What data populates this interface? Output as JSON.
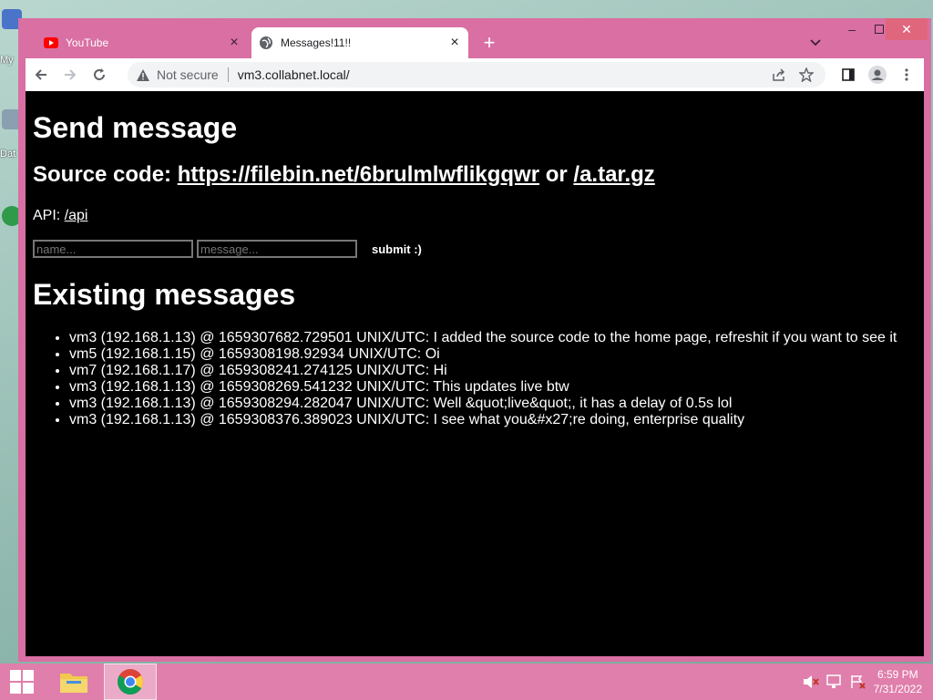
{
  "desktop": {
    "icon_labels": [
      "My",
      "Dat"
    ]
  },
  "browser": {
    "tabs": [
      {
        "title": "YouTube",
        "active": false,
        "favicon": "youtube-icon"
      },
      {
        "title": "Messages!11!!",
        "active": true,
        "favicon": "globe-icon"
      }
    ],
    "address_bar": {
      "security_text": "Not secure",
      "url": "vm3.collabnet.local/"
    }
  },
  "page": {
    "heading": "Send message",
    "source_label": "Source code: ",
    "source_link": "https://filebin.net/6brulmlwflikgqwr",
    "source_or": " or ",
    "archive_link": "/a.tar.gz",
    "api_label": "API: ",
    "api_link": "/api",
    "form": {
      "name_placeholder": "name...",
      "message_placeholder": "message...",
      "submit_label": "submit :)"
    },
    "messages_heading": "Existing messages",
    "messages": [
      "vm3 (192.168.1.13) @ 1659307682.729501 UNIX/UTC: I added the source code to the home page, refreshit if you want to see it",
      "vm5 (192.168.1.15) @ 1659308198.92934 UNIX/UTC: Oi",
      "vm7 (192.168.1.17) @ 1659308241.274125 UNIX/UTC: Hi",
      "vm3 (192.168.1.13) @ 1659308269.541232 UNIX/UTC: This updates live btw",
      "vm3 (192.168.1.13) @ 1659308294.282047 UNIX/UTC: Well &quot;live&quot;, it has a delay of 0.5s lol",
      "vm3 (192.168.1.13) @ 1659308376.389023 UNIX/UTC: I see what you&#x27;re doing, enterprise quality"
    ]
  },
  "taskbar": {
    "time": "6:59 PM",
    "date": "7/31/2022"
  },
  "colors": {
    "window_frame": "#d96fa3",
    "taskbar": "#e07fab",
    "page_background": "#000000",
    "page_text": "#ffffff"
  }
}
